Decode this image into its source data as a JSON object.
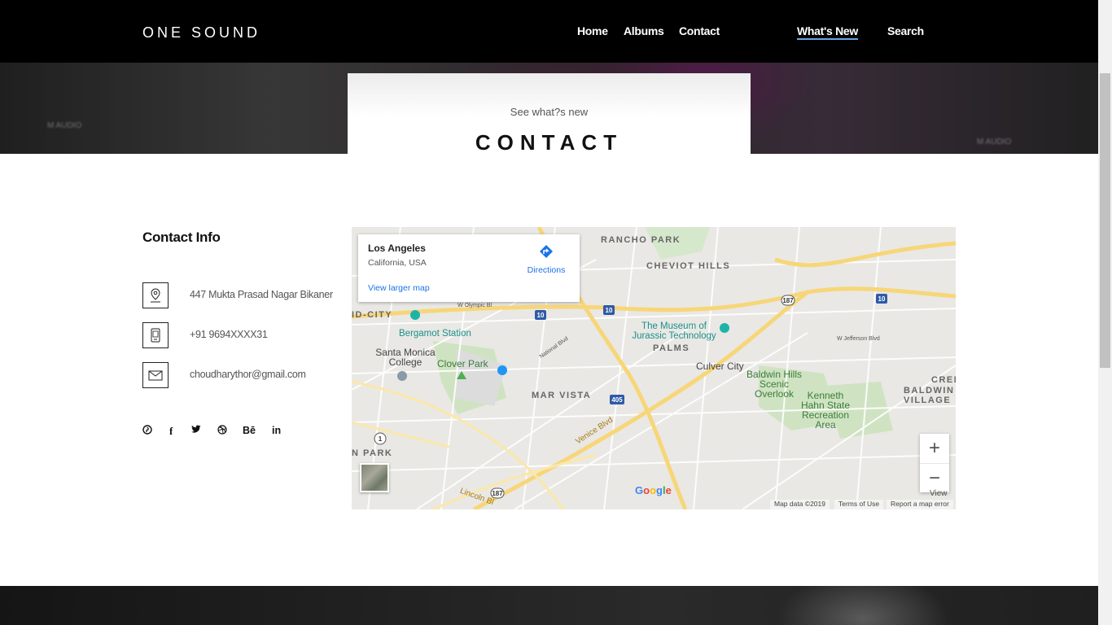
{
  "header": {
    "brand": "ONE SOUND",
    "nav": [
      {
        "label": "Home"
      },
      {
        "label": "Albums"
      },
      {
        "label": "Contact"
      },
      {
        "label": "What's New"
      },
      {
        "label": "Search"
      }
    ]
  },
  "hero": {
    "subtitle": "See what?s new",
    "title": "CONTACT",
    "bg_text_left": "M AUDIO",
    "bg_text_right": "M AUDIO"
  },
  "contact": {
    "heading": "Contact Info",
    "items": [
      {
        "icon": "map-pin-icon",
        "text": "447 Mukta Prasad Nagar Bikaner"
      },
      {
        "icon": "phone-icon",
        "text": "+91 9694XXXX31"
      },
      {
        "icon": "mail-icon",
        "text": "choudharythor@gmail.com"
      }
    ],
    "socials": [
      {
        "icon": "pinterest-icon",
        "glyph": "℗"
      },
      {
        "icon": "facebook-icon",
        "glyph": "f"
      },
      {
        "icon": "twitter-icon",
        "glyph": "🐦"
      },
      {
        "icon": "dribbble-icon",
        "glyph": "⊛"
      },
      {
        "icon": "behance-icon",
        "glyph": "Bē"
      },
      {
        "icon": "linkedin-icon",
        "glyph": "in"
      }
    ]
  },
  "map": {
    "place_name": "Los Angeles",
    "place_address": "California, USA",
    "directions_label": "Directions",
    "larger_map_label": "View larger map",
    "labels": {
      "rancho_park": "RANCHO PARK",
      "cheviot_hills": "CHEVIOT HILLS",
      "id_city": "ID-CITY",
      "bergamot": "Bergamot Station",
      "museum": "The Museum of Jurassic Technology",
      "palms": "PALMS",
      "santa_monica_college": "Santa Monica College",
      "clover_park": "Clover Park",
      "culver_city": "Culver City",
      "baldwin_hills": "Baldwin Hills Scenic Overlook",
      "mar_vista": "MAR VISTA",
      "kenneth_hahn": "Kenneth Hahn State Recreation Area",
      "cren": "CREN",
      "baldwin_village": "BALDWIN VILLAGE",
      "venice_blvd": "Venice Blvd",
      "lincoln": "Lincoln Bl",
      "n_park": "N PARK",
      "w_olympic": "W Olympic Bl",
      "national_blvd": "National Blvd",
      "w_jefferson": "W Jefferson Blvd"
    },
    "shields": [
      "10",
      "10",
      "10",
      "405",
      "187",
      "187",
      "1"
    ],
    "google": "Google",
    "map_data": "Map data ©2019",
    "terms": "Terms of Use",
    "report": "Report a map error",
    "view": "View",
    "zoom_in": "+",
    "zoom_out": "−"
  }
}
